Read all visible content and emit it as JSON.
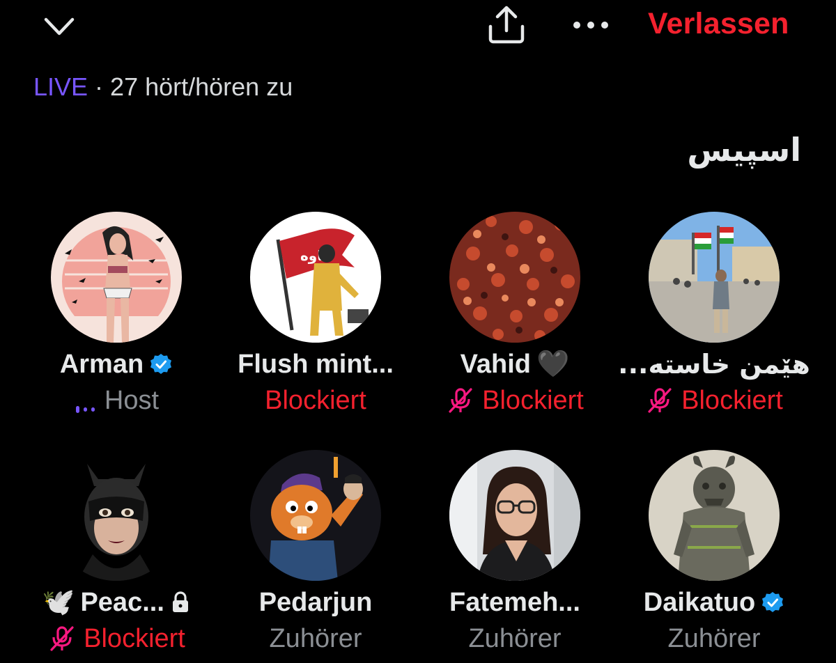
{
  "header": {
    "collapse_icon": "chevron-down-icon",
    "share_icon": "share-icon",
    "more_icon": "more-dots-icon",
    "leave_label": "Verlassen"
  },
  "live": {
    "badge": "LIVE",
    "separator": " · ",
    "listeners": "27 hört/hören zu"
  },
  "space": {
    "title": "اسپیس"
  },
  "colors": {
    "accent_red": "#f4212e",
    "live_purple": "#7856ff",
    "verified_blue": "#1d9bf0",
    "muted_pink": "#f91880"
  },
  "participants": [
    {
      "name": "Arman",
      "verified": true,
      "status": "Host",
      "status_type": "host",
      "avatar": "illustrated-woman-avatar"
    },
    {
      "name": "Flush mint...",
      "verified": false,
      "status": "Blockiert",
      "status_type": "blocked",
      "avatar": "kaveh-flag-avatar"
    },
    {
      "name": "Vahid",
      "emoji": "🖤",
      "verified": false,
      "status": "Blockiert",
      "status_type": "blocked-muted",
      "avatar": "autumn-leaves-avatar"
    },
    {
      "name": "هێمن خاستە...",
      "verified": false,
      "status": "Blockiert",
      "status_type": "blocked-muted",
      "avatar": "street-flags-avatar"
    },
    {
      "name": "Peac...",
      "prefix_emoji": "🕊️",
      "locked": true,
      "verified": false,
      "status": "Blockiert",
      "status_type": "blocked-muted",
      "avatar": "catwoman-avatar"
    },
    {
      "name": "Pedarjun",
      "verified": false,
      "status": "Zuhörer",
      "status_type": "listener",
      "avatar": "cartoon-beaver-avatar"
    },
    {
      "name": "Fatemeh...",
      "verified": false,
      "status": "Zuhörer",
      "status_type": "listener",
      "avatar": "woman-portrait-avatar"
    },
    {
      "name": "Daikatuo",
      "verified": true,
      "status": "Zuhörer",
      "status_type": "listener",
      "avatar": "stone-statue-avatar"
    }
  ]
}
